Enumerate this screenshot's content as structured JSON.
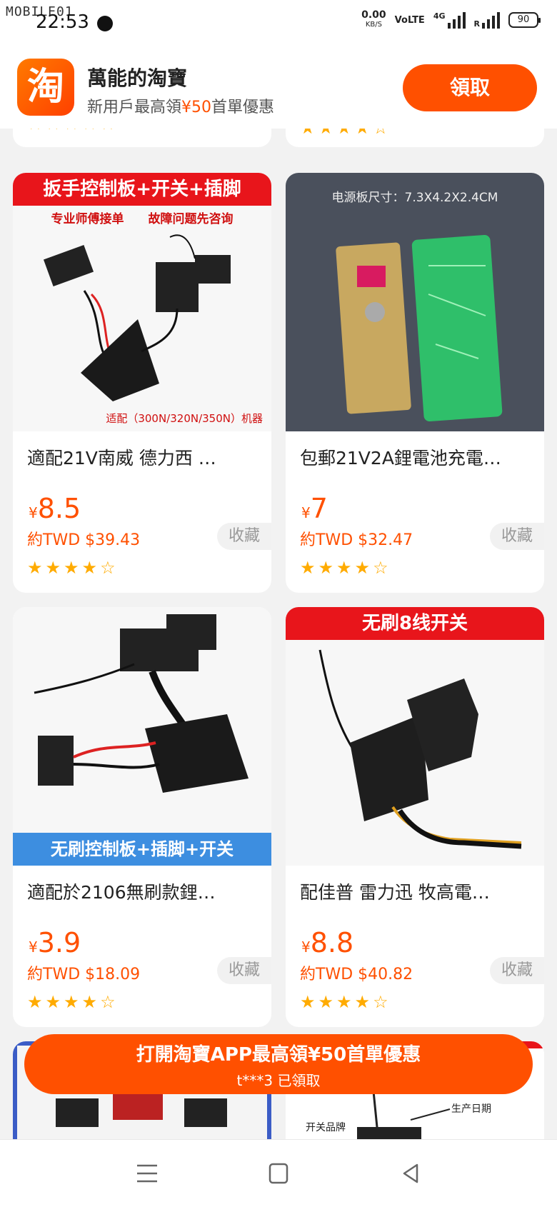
{
  "status_bar": {
    "watermark": "MOBILE01",
    "time": "22:53",
    "net_speed": "0.00",
    "net_unit": "KB/S",
    "volte": "VoLTE",
    "net_type": "4G",
    "roaming": "R",
    "battery": "90"
  },
  "app_banner": {
    "logo_char": "淘",
    "title": "萬能的淘寶",
    "subtitle_pre": "新用戶最高領",
    "subtitle_amount": "¥50",
    "subtitle_post": "首單優惠",
    "claim_label": "領取"
  },
  "products": [
    {
      "thumb_header": "扳手控制板+开关+插脚",
      "thumb_sub": "专业师傅接单　　故障问题先咨询",
      "thumb_foot": "适配（300N/320N/350N）机器",
      "title": "適配21V南威 德力西 …",
      "currency": "¥",
      "price": "8.5",
      "twd": "約TWD $39.43",
      "fav_label": "收藏",
      "rating": 4
    },
    {
      "thumb_text": "电源板尺寸：7.3X4.2X2.4CM",
      "title": "包郵21V2A鋰電池充電…",
      "currency": "¥",
      "price": "7",
      "twd": "約TWD $32.47",
      "fav_label": "收藏",
      "rating": 4
    },
    {
      "thumb_footer": "无刷控制板+插脚+开关",
      "title": "適配於2106無刷款鋰…",
      "currency": "¥",
      "price": "3.9",
      "twd": "約TWD $18.09",
      "fav_label": "收藏",
      "rating": 4
    },
    {
      "thumb_header": "无刷8线开关",
      "title": "配佳普 雷力迅 牧高電…",
      "currency": "¥",
      "price": "8.8",
      "twd": "約TWD $40.82",
      "fav_label": "收藏",
      "rating": 4
    }
  ],
  "partial_products": {
    "right_label_1": "开关品牌",
    "right_label_2": "生产日期"
  },
  "cta": {
    "main": "打開淘寶APP最高領¥50首單優惠",
    "sub": "t***3 已領取"
  },
  "colors": {
    "accent": "#ff5000",
    "star": "#ffab00",
    "red_banner": "#e8151b",
    "blue_banner": "#3d8ee0"
  },
  "icons": [
    "menu-icon",
    "home-square-icon",
    "back-triangle-icon"
  ]
}
